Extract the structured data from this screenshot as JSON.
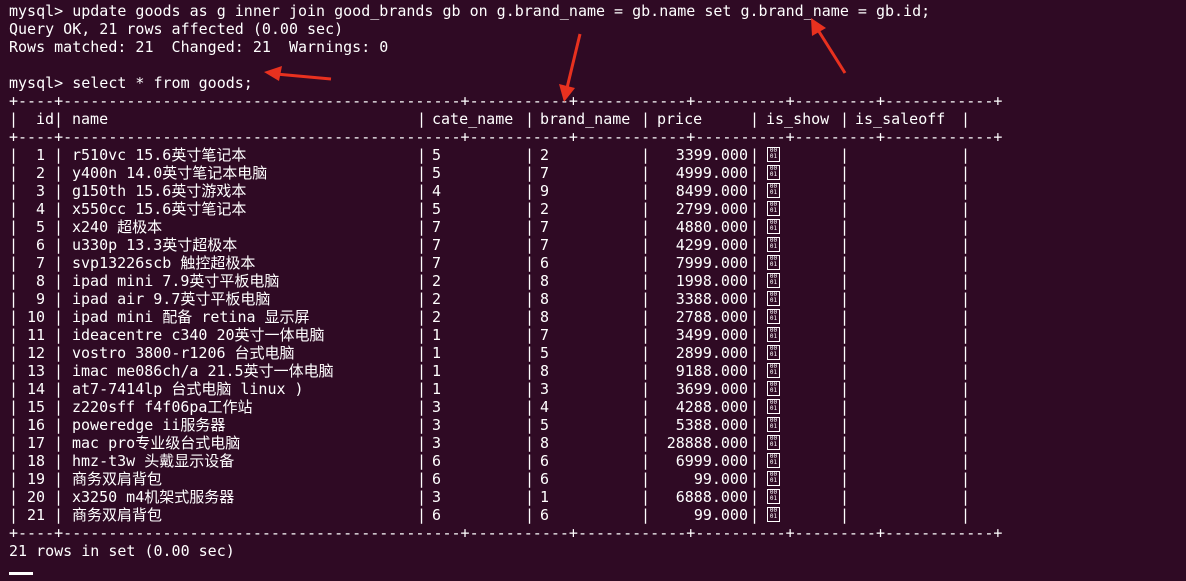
{
  "terminal": {
    "command1": "mysql> update goods as g inner join good_brands gb on g.brand_name = gb.name set g.brand_name = gb.id;",
    "result1_line1": "Query OK, 21 rows affected (0.00 sec)",
    "result1_line2": "Rows matched: 21  Changed: 21  Warnings: 0",
    "command2": "mysql> select * from goods;",
    "table_border": "+----+--------------------------------------------+-----------+------------+----------+---------+------------+",
    "header_line": "| id | name                                       | cate_name | brand_name | price    | is_show | is_saleoff |",
    "footer": "21 rows in set (0.00 sec)"
  },
  "table": {
    "columns": [
      "id",
      "name",
      "cate_name",
      "brand_name",
      "price",
      "is_show",
      "is_saleoff"
    ],
    "rows": [
      {
        "id": "1",
        "name": "r510vc 15.6英寸笔记本",
        "cate_name": "5",
        "brand_name": "2",
        "price": "3399.000"
      },
      {
        "id": "2",
        "name": "y400n 14.0英寸笔记本电脑",
        "cate_name": "5",
        "brand_name": "7",
        "price": "4999.000"
      },
      {
        "id": "3",
        "name": "g150th 15.6英寸游戏本",
        "cate_name": "4",
        "brand_name": "9",
        "price": "8499.000"
      },
      {
        "id": "4",
        "name": "x550cc 15.6英寸笔记本",
        "cate_name": "5",
        "brand_name": "2",
        "price": "2799.000"
      },
      {
        "id": "5",
        "name": "x240 超极本",
        "cate_name": "7",
        "brand_name": "7",
        "price": "4880.000"
      },
      {
        "id": "6",
        "name": "u330p 13.3英寸超极本",
        "cate_name": "7",
        "brand_name": "7",
        "price": "4299.000"
      },
      {
        "id": "7",
        "name": "svp13226scb 触控超极本",
        "cate_name": "7",
        "brand_name": "6",
        "price": "7999.000"
      },
      {
        "id": "8",
        "name": "ipad mini 7.9英寸平板电脑",
        "cate_name": "2",
        "brand_name": "8",
        "price": "1998.000"
      },
      {
        "id": "9",
        "name": "ipad air 9.7英寸平板电脑",
        "cate_name": "2",
        "brand_name": "8",
        "price": "3388.000"
      },
      {
        "id": "10",
        "name": "ipad mini 配备 retina 显示屏",
        "cate_name": "2",
        "brand_name": "8",
        "price": "2788.000"
      },
      {
        "id": "11",
        "name": "ideacentre c340 20英寸一体电脑",
        "cate_name": "1",
        "brand_name": "7",
        "price": "3499.000"
      },
      {
        "id": "12",
        "name": "vostro 3800-r1206 台式电脑",
        "cate_name": "1",
        "brand_name": "5",
        "price": "2899.000"
      },
      {
        "id": "13",
        "name": "imac me086ch/a 21.5英寸一体电脑",
        "cate_name": "1",
        "brand_name": "8",
        "price": "9188.000"
      },
      {
        "id": "14",
        "name": "at7-7414lp 台式电脑 linux )",
        "cate_name": "1",
        "brand_name": "3",
        "price": "3699.000"
      },
      {
        "id": "15",
        "name": "z220sff f4f06pa工作站",
        "cate_name": "3",
        "brand_name": "4",
        "price": "4288.000"
      },
      {
        "id": "16",
        "name": "poweredge ii服务器",
        "cate_name": "3",
        "brand_name": "5",
        "price": "5388.000"
      },
      {
        "id": "17",
        "name": "mac pro专业级台式电脑",
        "cate_name": "3",
        "brand_name": "8",
        "price": "28888.000"
      },
      {
        "id": "18",
        "name": "hmz-t3w 头戴显示设备",
        "cate_name": "6",
        "brand_name": "6",
        "price": "6999.000"
      },
      {
        "id": "19",
        "name": "商务双肩背包",
        "cate_name": "6",
        "brand_name": "6",
        "price": "99.000"
      },
      {
        "id": "20",
        "name": "x3250 m4机架式服务器",
        "cate_name": "3",
        "brand_name": "1",
        "price": "6888.000"
      },
      {
        "id": "21",
        "name": "商务双肩背包",
        "cate_name": "6",
        "brand_name": "6",
        "price": "99.000"
      }
    ],
    "is_show_glyph": "0001",
    "is_show_icon": "binary-glyph-box"
  },
  "colors": {
    "background": "#2f0a24",
    "text": "#ffffff",
    "arrow": "#e8311f"
  },
  "annotations": {
    "arrow_icon": "red-arrow-icon"
  }
}
